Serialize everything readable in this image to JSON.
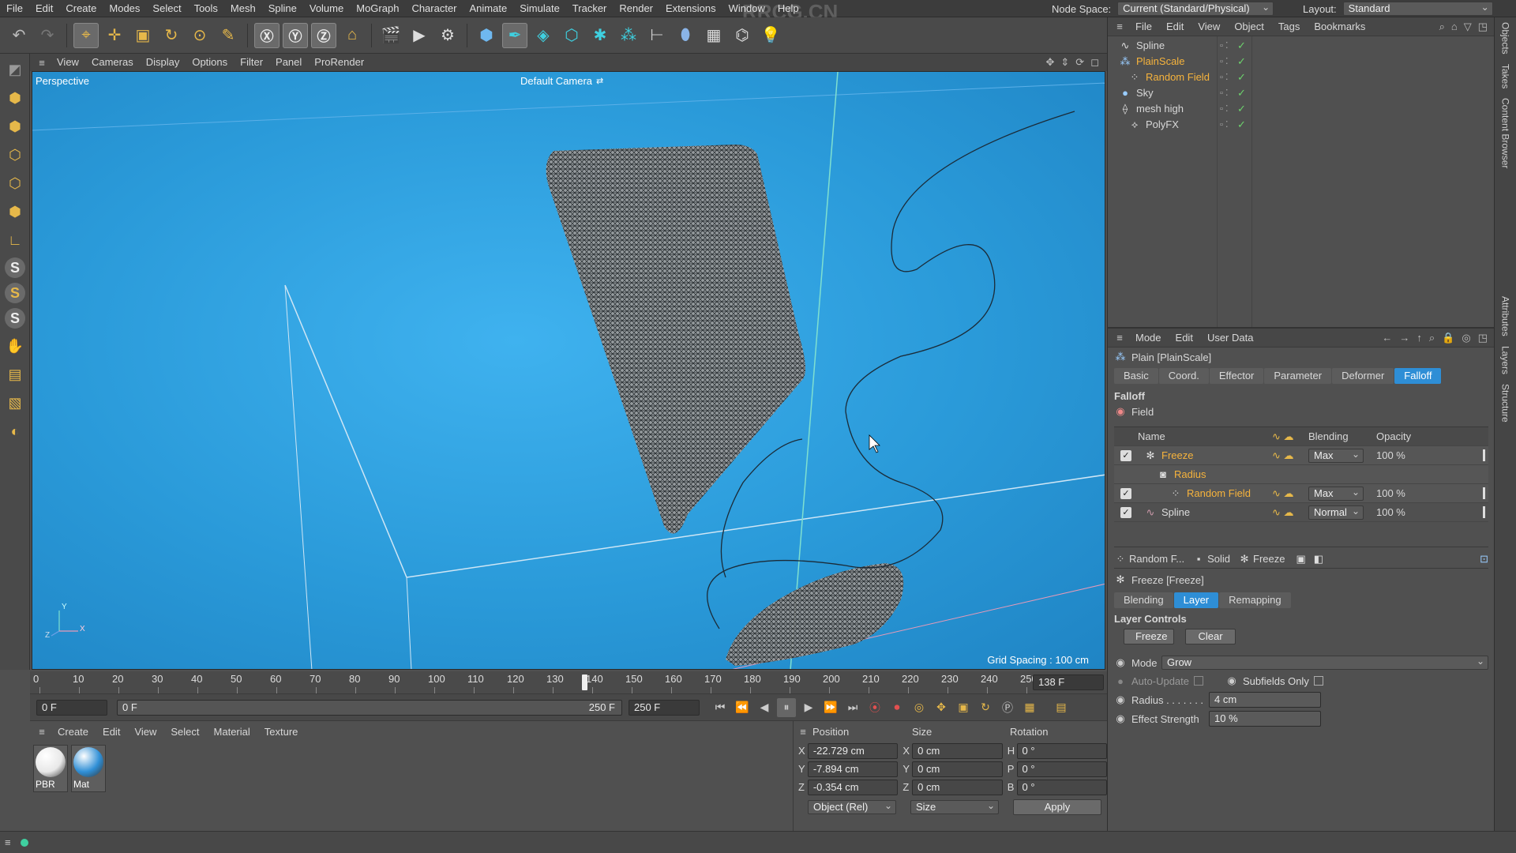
{
  "menubar": {
    "items": [
      "File",
      "Edit",
      "Create",
      "Modes",
      "Select",
      "Tools",
      "Mesh",
      "Spline",
      "Volume",
      "MoGraph",
      "Character",
      "Animate",
      "Simulate",
      "Tracker",
      "Render",
      "Extensions",
      "Window",
      "Help"
    ],
    "node_space_label": "Node Space:",
    "node_space_value": "Current (Standard/Physical)",
    "layout_label": "Layout:",
    "layout_value": "Standard"
  },
  "watermark": "RRCG.CN",
  "viewport": {
    "menu": [
      "View",
      "Cameras",
      "Display",
      "Options",
      "Filter",
      "Panel",
      "ProRender"
    ],
    "mode_label": "Perspective",
    "camera_label": "Default Camera",
    "grid_spacing": "Grid Spacing : 100 cm",
    "axis_labels": {
      "x": "X",
      "y": "Y",
      "z": "Z"
    }
  },
  "timeline": {
    "ticks": [
      "0",
      "10",
      "20",
      "30",
      "40",
      "50",
      "60",
      "70",
      "80",
      "90",
      "100",
      "110",
      "120",
      "130",
      "140",
      "150",
      "160",
      "170",
      "180",
      "190",
      "200",
      "210",
      "220",
      "230",
      "240",
      "250"
    ],
    "current_frame": "138 F",
    "playhead_value": 138,
    "max_frame": 250
  },
  "playbar": {
    "start_field": "0 F",
    "range_start": "0 F",
    "range_end": "250 F",
    "end_field": "250 F"
  },
  "material_panel": {
    "menu": [
      "Create",
      "Edit",
      "View",
      "Select",
      "Material",
      "Texture"
    ],
    "materials": [
      {
        "label": "PBR",
        "color": "#e8e8e8"
      },
      {
        "label": "Mat",
        "color": "#2f8fd6"
      }
    ]
  },
  "coord_panel": {
    "headers": {
      "position": "Position",
      "size": "Size",
      "rotation": "Rotation"
    },
    "rows": [
      {
        "axis": "X",
        "pos": "-22.729 cm",
        "saxis": "X",
        "size": "0 cm",
        "raxis": "H",
        "rot": "0 °"
      },
      {
        "axis": "Y",
        "pos": "-7.894 cm",
        "saxis": "Y",
        "size": "0 cm",
        "raxis": "P",
        "rot": "0 °"
      },
      {
        "axis": "Z",
        "pos": "-0.354 cm",
        "saxis": "Z",
        "size": "0 cm",
        "raxis": "B",
        "rot": "0 °"
      }
    ],
    "mode_select": "Object (Rel)",
    "size_select": "Size",
    "apply_label": "Apply"
  },
  "object_panel": {
    "menu": [
      "File",
      "Edit",
      "View",
      "Object",
      "Tags",
      "Bookmarks"
    ],
    "objects": [
      {
        "name": "Spline",
        "indent": 0,
        "selected": false,
        "icon": "spline-icon"
      },
      {
        "name": "PlainScale",
        "indent": 0,
        "selected": true,
        "icon": "plain-effector-icon"
      },
      {
        "name": "Random Field",
        "indent": 1,
        "selected": true,
        "icon": "random-field-icon"
      },
      {
        "name": "Sky",
        "indent": 0,
        "selected": false,
        "icon": "sky-icon"
      },
      {
        "name": "mesh high",
        "indent": 0,
        "selected": false,
        "icon": "mesh-icon"
      },
      {
        "name": "PolyFX",
        "indent": 1,
        "selected": false,
        "icon": "polyfx-icon"
      }
    ]
  },
  "attr_panel": {
    "menu": [
      "Mode",
      "Edit",
      "User Data"
    ],
    "title": "Plain [PlainScale]",
    "tabs": [
      "Basic",
      "Coord.",
      "Effector",
      "Parameter",
      "Deformer",
      "Falloff"
    ],
    "active_tab": "Falloff",
    "section": "Falloff",
    "field_label": "Field",
    "table_headers": {
      "name": "Name",
      "blending": "Blending",
      "opacity": "Opacity"
    },
    "fields": [
      {
        "name": "Freeze",
        "blending": "Max",
        "opacity": "100 %",
        "indent": 0,
        "checked": true,
        "icon": "freeze-icon"
      },
      {
        "name": "Radius",
        "blending": "",
        "opacity": "",
        "indent": 1,
        "checked": false,
        "icon": "radius-icon"
      },
      {
        "name": "Random Field",
        "blending": "Max",
        "opacity": "100 %",
        "indent": 2,
        "checked": true,
        "icon": "random-field-icon"
      },
      {
        "name": "Spline",
        "blending": "Normal",
        "opacity": "100 %",
        "indent": 0,
        "checked": true,
        "icon": "spline-field-icon"
      }
    ],
    "subtabs": [
      "Random F...",
      "Solid",
      "Freeze"
    ],
    "sub_title": "Freeze [Freeze]",
    "freeze_tabs": [
      "Blending",
      "Layer",
      "Remapping"
    ],
    "freeze_active": "Layer",
    "layer_controls": "Layer Controls",
    "freeze_btn": "Freeze",
    "clear_btn": "Clear",
    "mode_label": "Mode",
    "mode_value": "Grow",
    "auto_update": "Auto-Update",
    "subfields_only": "Subfields Only",
    "radius_label": "Radius . . . . . . .",
    "radius_value": "4 cm",
    "strength_label": "Effect Strength",
    "strength_value": "10 %"
  },
  "side_tabs": [
    "Objects",
    "Takes",
    "Content Browser",
    "Attributes",
    "Layers",
    "Structure"
  ],
  "colors": {
    "accent": "#2e8ed6",
    "selected": "#f6b33c",
    "viewport": "#2a9ad9"
  }
}
